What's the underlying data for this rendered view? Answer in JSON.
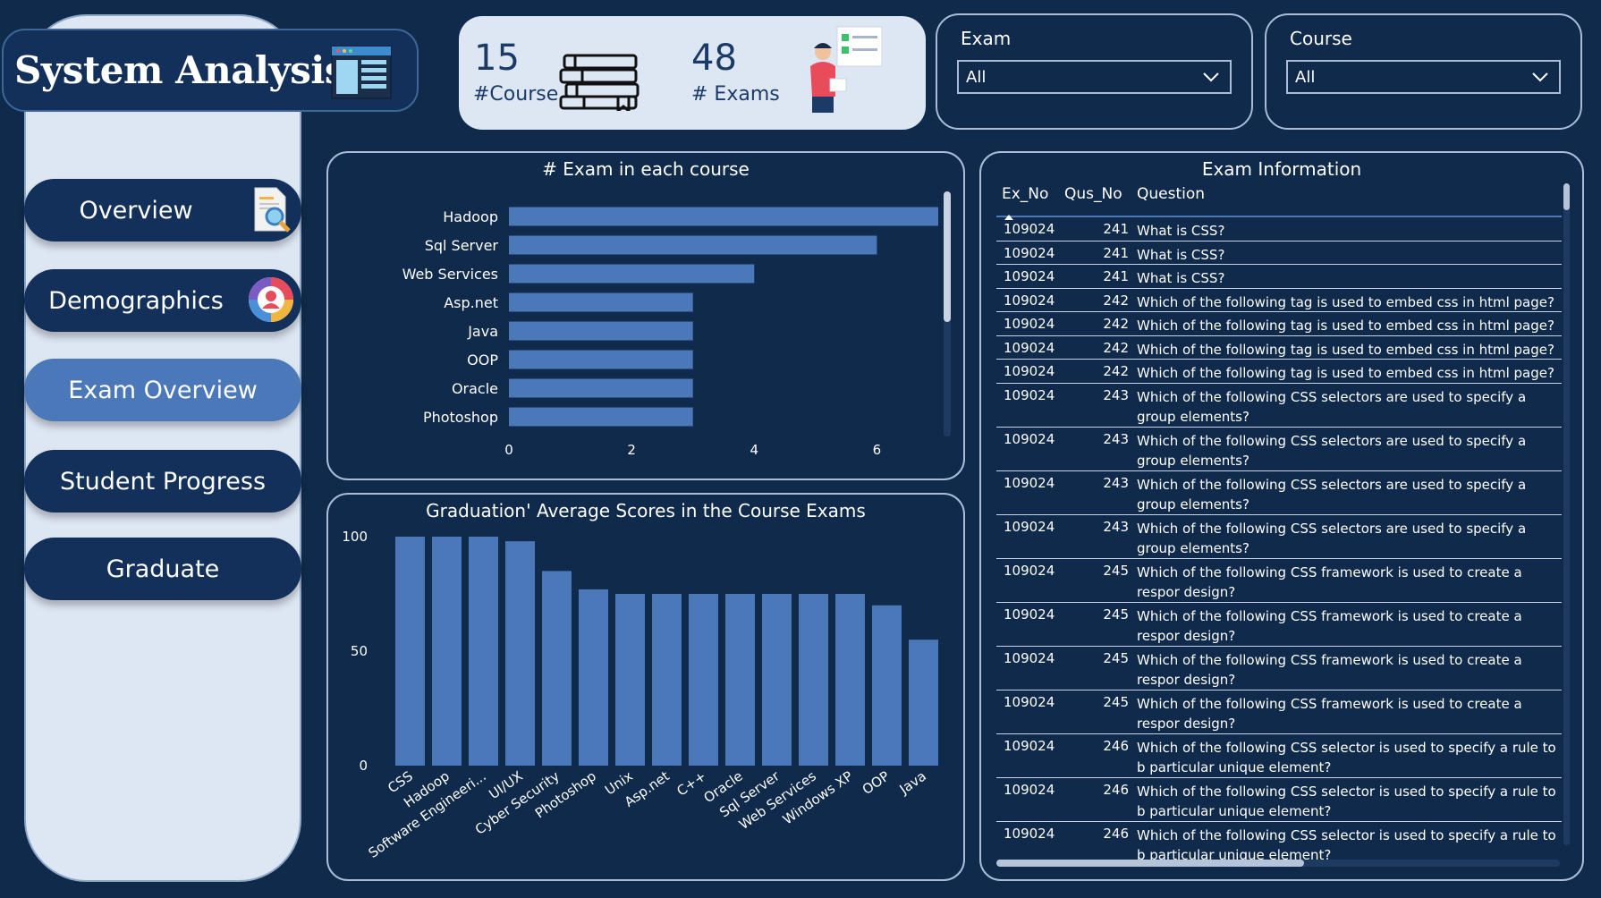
{
  "brand": {
    "title": "System Analysis"
  },
  "nav": {
    "overview": "Overview",
    "demographics": "Demographics",
    "exam_overview": "Exam Overview",
    "student_progress": "Student Progress",
    "graduate": "Graduate"
  },
  "kpis": {
    "courses_value": "15",
    "courses_label": "#Course",
    "exams_value": "48",
    "exams_label": "# Exams"
  },
  "slicers": {
    "exam": {
      "title": "Exam",
      "value": "All"
    },
    "course": {
      "title": "Course",
      "value": "All"
    }
  },
  "colors": {
    "background": "#0f2a4a",
    "bar": "#4a78b8",
    "card": "#dde6f3",
    "active_nav": "#4a78b8"
  },
  "chart_data": [
    {
      "type": "bar",
      "orientation": "horizontal",
      "title": "# Exam in each course",
      "categories": [
        "Hadoop",
        "Sql Server",
        "Web Services",
        "Asp.net",
        "Java",
        "OOP",
        "Oracle",
        "Photoshop"
      ],
      "values": [
        7,
        6,
        4,
        3,
        3,
        3,
        3,
        3
      ],
      "xticks": [
        "0",
        "2",
        "4",
        "6"
      ],
      "xlim": [
        0,
        7
      ]
    },
    {
      "type": "bar",
      "title": "Graduation' Average Scores in the Course Exams",
      "categories": [
        "CSS",
        "Hadoop",
        "Software Engineeri...",
        "UI/UX",
        "Cyber Security",
        "Photoshop",
        "Unix",
        "Asp.net",
        "C++",
        "Oracle",
        "Sql Server",
        "Web Services",
        "Windows XP",
        "OOP",
        "Java"
      ],
      "values": [
        100,
        100,
        100,
        98,
        85,
        77,
        75,
        75,
        75,
        75,
        75,
        75,
        75,
        70,
        55
      ],
      "yticks": [
        "0",
        "50",
        "100"
      ],
      "ylim": [
        0,
        100
      ]
    }
  ],
  "exam_table": {
    "title": "Exam Information",
    "columns": [
      "Ex_No",
      "Qus_No",
      "Question"
    ],
    "rows": [
      {
        "ex": "109024",
        "qus": "241",
        "q": "What is CSS?"
      },
      {
        "ex": "109024",
        "qus": "241",
        "q": "What is CSS?"
      },
      {
        "ex": "109024",
        "qus": "241",
        "q": "What is CSS?"
      },
      {
        "ex": "109024",
        "qus": "242",
        "q": "Which of the following tag is used to embed css in html page?"
      },
      {
        "ex": "109024",
        "qus": "242",
        "q": "Which of the following tag is used to embed css in html page?"
      },
      {
        "ex": "109024",
        "qus": "242",
        "q": "Which of the following tag is used to embed css in html page?"
      },
      {
        "ex": "109024",
        "qus": "242",
        "q": "Which of the following tag is used to embed css in html page?"
      },
      {
        "ex": "109024",
        "qus": "243",
        "q": "Which of the following CSS selectors are used to specify a group elements?"
      },
      {
        "ex": "109024",
        "qus": "243",
        "q": "Which of the following CSS selectors are used to specify a group elements?"
      },
      {
        "ex": "109024",
        "qus": "243",
        "q": "Which of the following CSS selectors are used to specify a group elements?"
      },
      {
        "ex": "109024",
        "qus": "243",
        "q": "Which of the following CSS selectors are used to specify a group elements?"
      },
      {
        "ex": "109024",
        "qus": "245",
        "q": "Which of the following CSS framework is used to create a respor design?"
      },
      {
        "ex": "109024",
        "qus": "245",
        "q": "Which of the following CSS framework is used to create a respor design?"
      },
      {
        "ex": "109024",
        "qus": "245",
        "q": "Which of the following CSS framework is used to create a respor design?"
      },
      {
        "ex": "109024",
        "qus": "245",
        "q": "Which of the following CSS framework is used to create a respor design?"
      },
      {
        "ex": "109024",
        "qus": "246",
        "q": "Which of the following CSS selector is used to specify a rule to b particular unique element?"
      },
      {
        "ex": "109024",
        "qus": "246",
        "q": "Which of the following CSS selector is used to specify a rule to b particular unique element?"
      },
      {
        "ex": "109024",
        "qus": "246",
        "q": "Which of the following CSS selector is used to specify a rule to b particular unique element?"
      }
    ]
  }
}
